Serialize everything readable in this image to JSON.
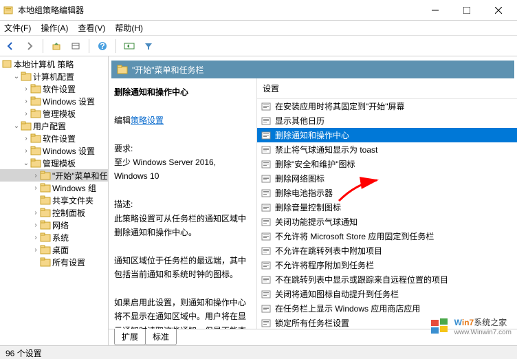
{
  "window": {
    "title": "本地组策略编辑器"
  },
  "menu": {
    "file": "文件(F)",
    "action": "操作(A)",
    "view": "查看(V)",
    "help": "帮助(H)"
  },
  "tree": {
    "root": "本地计算机 策略",
    "items": [
      {
        "label": "计算机配置",
        "exp": "v",
        "ind": 1
      },
      {
        "label": "软件设置",
        "exp": ">",
        "ind": 2
      },
      {
        "label": "Windows 设置",
        "exp": ">",
        "ind": 2
      },
      {
        "label": "管理模板",
        "exp": ">",
        "ind": 2
      },
      {
        "label": "用户配置",
        "exp": "v",
        "ind": 1
      },
      {
        "label": "软件设置",
        "exp": ">",
        "ind": 2
      },
      {
        "label": "Windows 设置",
        "exp": ">",
        "ind": 2
      },
      {
        "label": "管理模板",
        "exp": "v",
        "ind": 2
      },
      {
        "label": "\"开始\"菜单和任",
        "exp": ">",
        "ind": 3,
        "sel": true
      },
      {
        "label": "Windows 组",
        "exp": ">",
        "ind": 3
      },
      {
        "label": "共享文件夹",
        "exp": "",
        "ind": 3
      },
      {
        "label": "控制面板",
        "exp": ">",
        "ind": 3
      },
      {
        "label": "网络",
        "exp": ">",
        "ind": 3
      },
      {
        "label": "系统",
        "exp": ">",
        "ind": 3
      },
      {
        "label": "桌面",
        "exp": ">",
        "ind": 3
      },
      {
        "label": "所有设置",
        "exp": "",
        "ind": 3
      }
    ]
  },
  "header": {
    "title": "\"开始\"菜单和任务栏"
  },
  "detail": {
    "title": "删除通知和操作中心",
    "edit_prefix": "编辑",
    "edit_link": "策略设置",
    "req_label": "要求:",
    "req_text": "至少 Windows Server 2016, Windows 10",
    "desc_label": "描述:",
    "desc1": "此策略设置可从任务栏的通知区域中删除通知和操作中心。",
    "desc2": "通知区域位于任务栏的最远端，其中包括当前通知和系统时钟的图标。",
    "desc3": "如果启用此设置，则通知和操作中心将不显示在通知区域中。用户将在显示通知时读取这些通知，但是不能查看任何错过的通知。"
  },
  "settings": {
    "header": "设置",
    "items": [
      "在安装应用时将其固定到\"开始\"屏幕",
      "显示其他日历",
      "删除通知和操作中心",
      "禁止将气球通知显示为 toast",
      "删除\"安全和维护\"图标",
      "删除网络图标",
      "删除电池指示器",
      "删除音量控制图标",
      "关闭功能提示气球通知",
      "不允许将 Microsoft Store 应用固定到任务栏",
      "不允许在跳转列表中附加项目",
      "不允许将程序附加到任务栏",
      "不在跳转列表中显示或跟踪来自远程位置的项目",
      "关闭将通知图标自动提升到任务栏",
      "在任务栏上显示 Windows 应用商店应用",
      "锁定所有任务栏设置"
    ],
    "selected": 2
  },
  "tabs": {
    "extended": "扩展",
    "standard": "标准"
  },
  "status": {
    "text": "96 个设置"
  },
  "watermark": {
    "brand1": "W",
    "brand2": "in7",
    "rest": "系统之家",
    "url": "www.Winwin7.com"
  }
}
